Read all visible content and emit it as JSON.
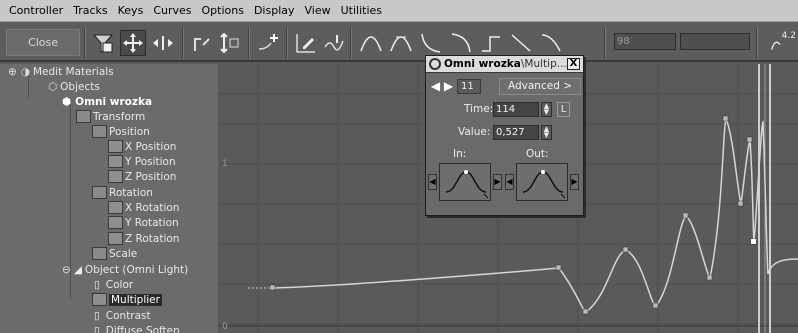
{
  "menubar": {
    "items": [
      "Controller",
      "Tracks",
      "Keys",
      "Curves",
      "Options",
      "Display",
      "View",
      "Utilities"
    ]
  },
  "toolbar": {
    "close_label": "Close",
    "frame_field": "98",
    "zoom_readout": "4.2",
    "icons": [
      "filter-icon",
      "move-keys-icon",
      "slide-keys-icon",
      "scale-keys-icon",
      "scale-values-icon",
      "add-keys-icon",
      "draw-curves-icon",
      "reduce-keys-icon",
      "auto-tangent-icon",
      "custom-tangent-icon",
      "fast-tangent-icon",
      "slow-tangent-icon",
      "step-tangent-icon",
      "linear-tangent-icon",
      "smooth-tangent-icon"
    ]
  },
  "tree": {
    "items": [
      {
        "label": "Medit Materials"
      },
      {
        "label": "Objects"
      },
      {
        "label": "Omni wrozka"
      },
      {
        "label": "Transform"
      },
      {
        "label": "Position"
      },
      {
        "label": "X Position"
      },
      {
        "label": "Y Position"
      },
      {
        "label": "Z Position"
      },
      {
        "label": "Rotation"
      },
      {
        "label": "X Rotation"
      },
      {
        "label": "Y Rotation"
      },
      {
        "label": "Z Rotation"
      },
      {
        "label": "Scale"
      },
      {
        "label": "Object (Omni Light)"
      },
      {
        "label": "Color"
      },
      {
        "label": "Multiplier"
      },
      {
        "label": "Contrast"
      },
      {
        "label": "Diffuse Soften"
      }
    ]
  },
  "graph": {
    "y_label_top": "1",
    "y_label_bottom": "0"
  },
  "dialog": {
    "title_main": "Omni wrozka",
    "title_sub": "\\Multip...",
    "close_glyph": "X",
    "key_number": "11",
    "advanced_label": "Advanced >",
    "time_label": "Time:",
    "time_value": "114",
    "lock_label": "L",
    "value_label": "Value:",
    "value_value": "0,527",
    "in_label": "In:",
    "out_label": "Out:"
  }
}
